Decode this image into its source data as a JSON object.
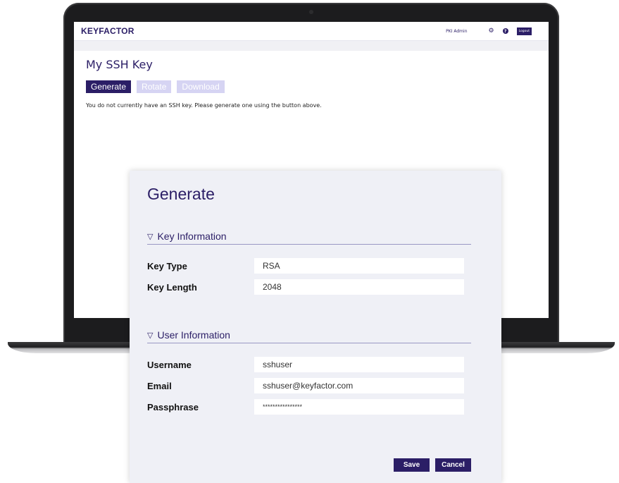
{
  "app": {
    "logo": "KEYFACTOR",
    "user": "PKI Admin",
    "logout_label": "Logout",
    "help_glyph": "?",
    "icons": {
      "settings": "gear-icon",
      "help": "question-icon"
    }
  },
  "page": {
    "title": "My SSH Key",
    "buttons": {
      "generate": "Generate",
      "rotate": "Rotate",
      "download": "Download"
    },
    "message": "You do not currently have an SSH key. Please generate one using the button above."
  },
  "modal": {
    "title": "Generate",
    "key_section": {
      "heading": "Key Information",
      "key_type_label": "Key Type",
      "key_type_value": "RSA",
      "key_length_label": "Key Length",
      "key_length_value": "2048"
    },
    "user_section": {
      "heading": "User Information",
      "username_label": "Username",
      "username_value": "sshuser",
      "email_label": "Email",
      "email_value": "sshuser@keyfactor.com",
      "passphrase_label": "Passphrase",
      "passphrase_value": "****************"
    },
    "save_label": "Save",
    "cancel_label": "Cancel"
  },
  "colors": {
    "brand": "#2b1e66",
    "disabled": "#d6d4f3",
    "modal_bg": "#eff0f6"
  }
}
